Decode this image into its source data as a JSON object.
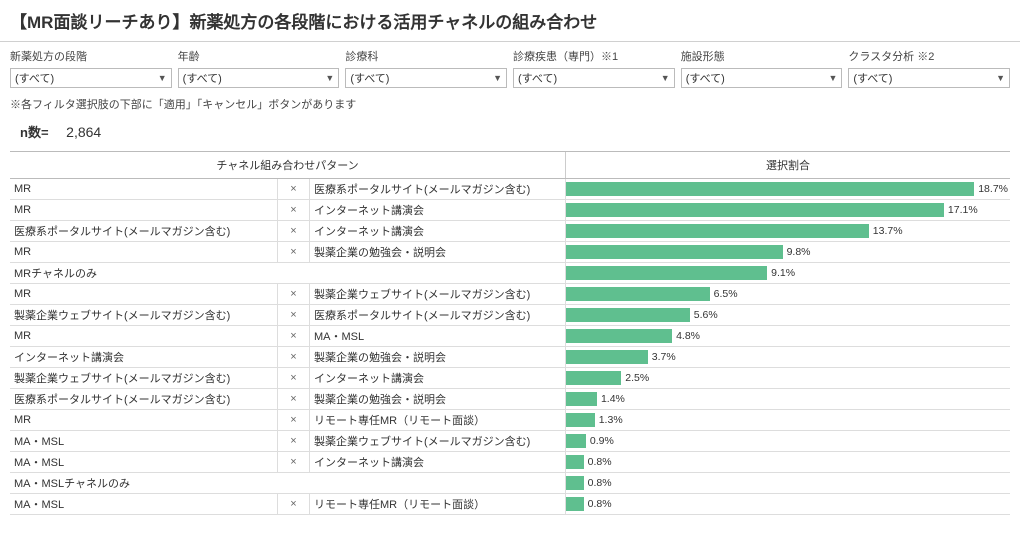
{
  "title": "【MR面談リーチあり】新薬処方の各段階における活用チャネルの組み合わせ",
  "filters": [
    {
      "label": "新薬処方の段階",
      "value": "(すべて)"
    },
    {
      "label": "年齢",
      "value": "(すべて)"
    },
    {
      "label": "診療科",
      "value": "(すべて)"
    },
    {
      "label": "診療疾患（専門）※1",
      "value": "(すべて)"
    },
    {
      "label": "施設形態",
      "value": "(すべて)"
    },
    {
      "label": "クラスタ分析 ※2",
      "value": "(すべて)"
    }
  ],
  "filter_note": "※各フィルタ選択肢の下部に「適用」「キャンセル」ボタンがあります",
  "n_label": "n数=",
  "n_value": "2,864",
  "col_header_left": "チャネル組み合わせパターン",
  "col_header_right": "選択割合",
  "max_percent": 20.0,
  "x_symbol": "×",
  "chart_data": {
    "type": "bar",
    "title": "選択割合",
    "xlabel": "選択割合 (%)",
    "ylabel": "チャネル組み合わせパターン",
    "xlim": [
      0,
      20
    ],
    "rows": [
      {
        "c1": "MR",
        "c2": "×",
        "c3": "医療系ポータルサイト(メールマガジン含む)",
        "value": 18.7,
        "label": "18.7%"
      },
      {
        "c1": "MR",
        "c2": "×",
        "c3": "インターネット講演会",
        "value": 17.1,
        "label": "17.1%"
      },
      {
        "c1": "医療系ポータルサイト(メールマガジン含む)",
        "c2": "×",
        "c3": "インターネット講演会",
        "value": 13.7,
        "label": "13.7%"
      },
      {
        "c1": "MR",
        "c2": "×",
        "c3": "製薬企業の勉強会・説明会",
        "value": 9.8,
        "label": "9.8%"
      },
      {
        "c1": "MRチャネルのみ",
        "c2": "",
        "c3": "",
        "value": 9.1,
        "label": "9.1%",
        "span": true
      },
      {
        "c1": "MR",
        "c2": "×",
        "c3": "製薬企業ウェブサイト(メールマガジン含む)",
        "value": 6.5,
        "label": "6.5%"
      },
      {
        "c1": "製薬企業ウェブサイト(メールマガジン含む)",
        "c2": "×",
        "c3": "医療系ポータルサイト(メールマガジン含む)",
        "value": 5.6,
        "label": "5.6%"
      },
      {
        "c1": "MR",
        "c2": "×",
        "c3": "MA・MSL",
        "value": 4.8,
        "label": "4.8%"
      },
      {
        "c1": "インターネット講演会",
        "c2": "×",
        "c3": "製薬企業の勉強会・説明会",
        "value": 3.7,
        "label": "3.7%"
      },
      {
        "c1": "製薬企業ウェブサイト(メールマガジン含む)",
        "c2": "×",
        "c3": "インターネット講演会",
        "value": 2.5,
        "label": "2.5%"
      },
      {
        "c1": "医療系ポータルサイト(メールマガジン含む)",
        "c2": "×",
        "c3": "製薬企業の勉強会・説明会",
        "value": 1.4,
        "label": "1.4%"
      },
      {
        "c1": "MR",
        "c2": "×",
        "c3": "リモート専任MR（リモート面談）",
        "value": 1.3,
        "label": "1.3%"
      },
      {
        "c1": "MA・MSL",
        "c2": "×",
        "c3": "製薬企業ウェブサイト(メールマガジン含む)",
        "value": 0.9,
        "label": "0.9%"
      },
      {
        "c1": "MA・MSL",
        "c2": "×",
        "c3": "インターネット講演会",
        "value": 0.8,
        "label": "0.8%"
      },
      {
        "c1": "MA・MSLチャネルのみ",
        "c2": "",
        "c3": "",
        "value": 0.8,
        "label": "0.8%",
        "span": true
      },
      {
        "c1": "MA・MSL",
        "c2": "×",
        "c3": "リモート専任MR（リモート面談）",
        "value": 0.8,
        "label": "0.8%"
      }
    ]
  }
}
